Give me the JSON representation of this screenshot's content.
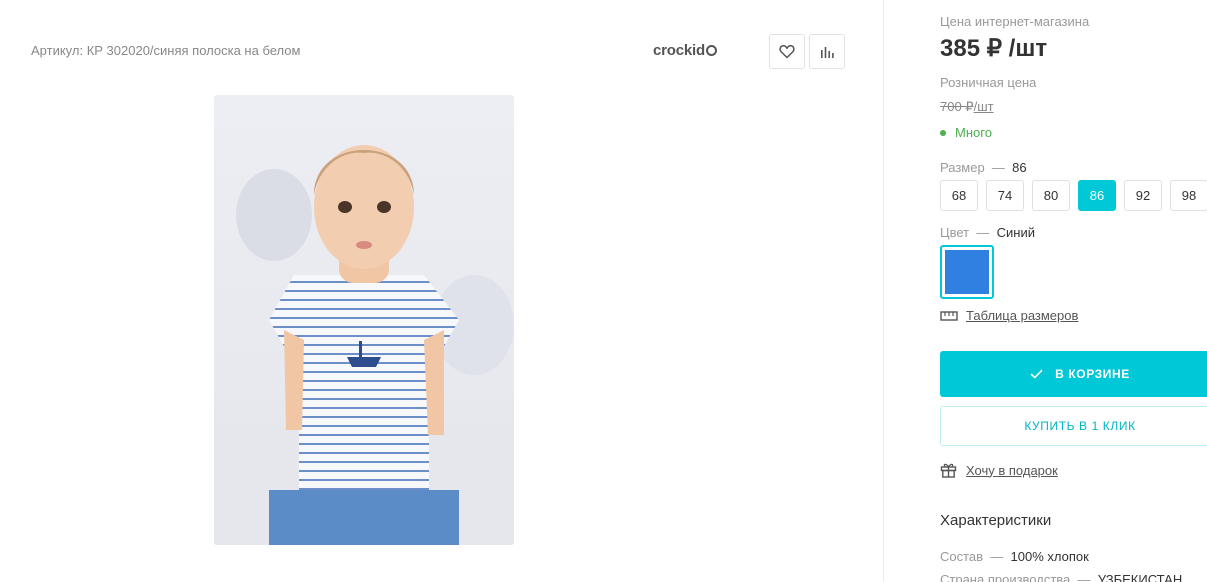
{
  "product": {
    "sku": "Артикул: КР 302020/синяя полоска на белом",
    "brand": "crockid",
    "photo_alt": "Детская футболка в синюю полоску"
  },
  "price": {
    "label": "Цена интернет-магазина",
    "value": "385 ₽ /шт",
    "retail_label": "Розничная цена",
    "retail_value": "700 ₽",
    "retail_unit": "/шт",
    "stock": "Много"
  },
  "size": {
    "label": "Размер",
    "dash": "—",
    "selected": "86",
    "options": [
      "68",
      "74",
      "80",
      "86",
      "92",
      "98"
    ]
  },
  "color": {
    "label": "Цвет",
    "dash": "—",
    "selected": "Синий",
    "swatch_hex": "#2f80e0"
  },
  "links": {
    "size_table": "Таблица размеров",
    "gift": "Хочу в подарок"
  },
  "buttons": {
    "cart": "В КОРЗИНЕ",
    "one_click": "КУПИТЬ В 1 КЛИК"
  },
  "characteristics": {
    "title": "Характеристики",
    "rows": [
      {
        "label": "Состав",
        "dash": "—",
        "value": "100% хлопок"
      },
      {
        "label": "Страна производства",
        "dash": "—",
        "value": "УЗБЕКИСТАН"
      }
    ]
  },
  "colors": {
    "accent": "#00c8d7",
    "in_stock": "#4caf50"
  },
  "icons": [
    "heart-icon",
    "compare-icon",
    "ruler-icon",
    "check-icon",
    "gift-icon"
  ]
}
